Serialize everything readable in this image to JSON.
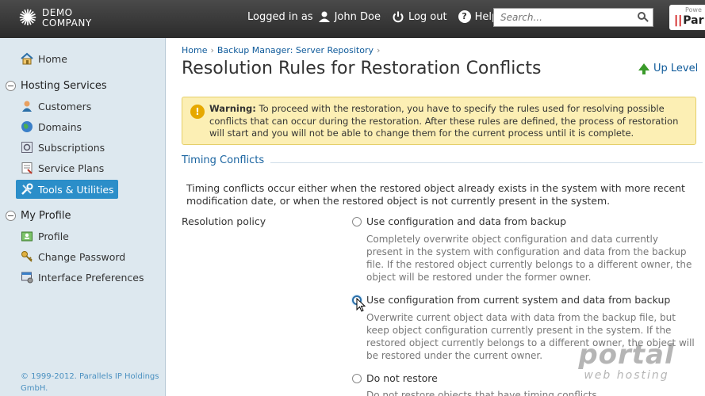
{
  "header": {
    "logo_line1": "DEMO",
    "logo_line2": "COMPANY",
    "logged_in_prefix": "Logged in as",
    "user_name": "John Doe",
    "logout_label": "Log out",
    "help_label": "Help",
    "search_placeholder": "Search...",
    "brand_small": "Powe",
    "brand_big": "Par"
  },
  "sidebar": {
    "home": "Home",
    "group_hosting": "Hosting Services",
    "hosting_items": [
      "Customers",
      "Domains",
      "Subscriptions",
      "Service Plans",
      "Tools & Utilities"
    ],
    "group_profile": "My Profile",
    "profile_items": [
      "Profile",
      "Change Password",
      "Interface Preferences"
    ],
    "copyright": "© 1999-2012. Parallels IP Holdings GmbH."
  },
  "main": {
    "breadcrumb": [
      "Home",
      "Backup Manager: Server Repository"
    ],
    "title": "Resolution Rules for Restoration Conflicts",
    "up_level": "Up Level",
    "warning_bold": "Warning:",
    "warning_text": " To proceed with the restoration, you have to specify the rules used for resolving possible conflicts that can occur during the restoration. After these rules are defined, the process of restoration will start and you will not be able to change them for the current process until it is complete.",
    "section_title": "Timing Conflicts",
    "intro": "Timing conflicts occur either when the restored object already exists in the system with more recent modification date, or when the restored object is not currently present in the system.",
    "policy_label": "Resolution policy",
    "options": [
      {
        "label": "Use configuration and data from backup",
        "desc": "Completely overwrite object configuration and data currently present in the system with configuration and data from the backup file. If the restored object currently belongs to a different owner, the object will be restored under the former owner."
      },
      {
        "label": "Use configuration from current system and data from backup",
        "desc": "Overwrite current object data with data from the backup file, but keep object configuration currently present in the system. If the restored object currently belongs to a different owner, the object will be restored under the current owner."
      },
      {
        "label": "Do not restore",
        "desc": "Do not restore objects that have timing conflicts"
      }
    ]
  },
  "watermark": {
    "line1": "portal",
    "line2": "web hosting"
  },
  "colors": {
    "header_bg": "#333333",
    "sidebar_bg": "#dde8ef",
    "active_nav": "#2b8ec9",
    "link": "#0e5a9a",
    "warning_bg": "#fcefb4"
  }
}
